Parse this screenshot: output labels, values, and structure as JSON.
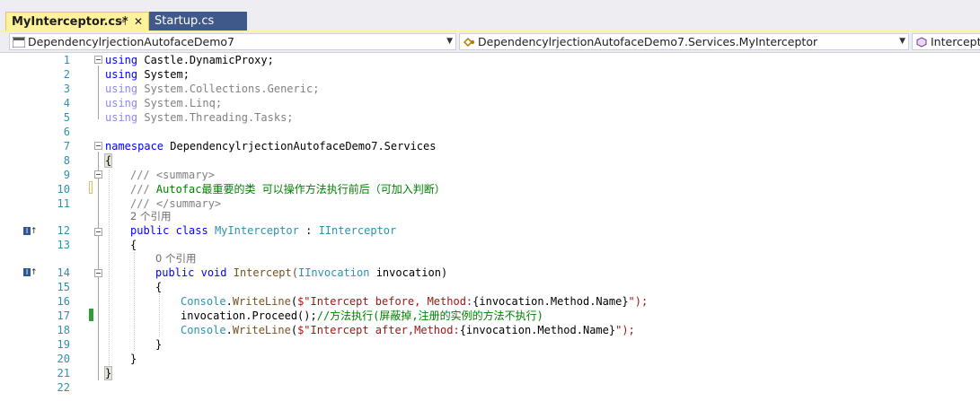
{
  "tabs": [
    {
      "label": "MyInterceptor.cs*",
      "active": true,
      "pin_icon": "pin-icon",
      "close_icon": "close-icon"
    },
    {
      "label": "Startup.cs",
      "active": false
    }
  ],
  "nav": {
    "project": "DependencylrjectionAutofaceDemo7",
    "type": "DependencylrjectionAutofaceDemo7.Services.MyInterceptor",
    "member": "Intercept("
  },
  "lines": [
    {
      "n": "1"
    },
    {
      "n": "2"
    },
    {
      "n": "3"
    },
    {
      "n": "4"
    },
    {
      "n": "5"
    },
    {
      "n": "6"
    },
    {
      "n": "7"
    },
    {
      "n": "8"
    },
    {
      "n": "9"
    },
    {
      "n": "10"
    },
    {
      "n": "11"
    },
    {
      "n": "12"
    },
    {
      "n": "13"
    },
    {
      "n": "14"
    },
    {
      "n": "15"
    },
    {
      "n": "16"
    },
    {
      "n": "17"
    },
    {
      "n": "18"
    },
    {
      "n": "19"
    },
    {
      "n": "20"
    },
    {
      "n": "21"
    },
    {
      "n": "22"
    }
  ],
  "code": {
    "l1_kw": "using",
    "l1_rest": " Castle.DynamicProxy;",
    "l2_kw": "using",
    "l2_rest": " System;",
    "l3_kw": "using",
    "l3_rest": " System.Collections.Generic;",
    "l4_kw": "using",
    "l4_rest": " System.Linq;",
    "l5_kw": "using",
    "l5_rest": " System.Threading.Tasks;",
    "l7_kw": "namespace",
    "l7_rest": " DependencylrjectionAutofaceDemo7.Services",
    "l8": "{",
    "l9_a": "/// ",
    "l9_b": "<summary>",
    "l10_a": "/// ",
    "l10_b": "Autofac最重要的类 可以操作方法执行前后（可加入判断）",
    "l11_a": "/// ",
    "l11_b": "</summary>",
    "ref_class": "2 个引用",
    "l12_kw1": "public",
    "l12_kw2": "class",
    "l12_name": "MyInterceptor",
    "l12_sep": " : ",
    "l12_base": "IInterceptor",
    "l13": "{",
    "ref_method": "0 个引用",
    "l14_kw1": "public",
    "l14_kw2": "void",
    "l14_name": "Intercept(",
    "l14_type": "IInvocation",
    "l14_rest": " invocation)",
    "l15": "{",
    "l16_cls": "Console",
    "l16_dot": ".",
    "l16_m": "WriteLine",
    "l16_p": "(",
    "l16_str": "$\"Intercept before, Method:",
    "l16_interp": "{invocation.Method.Name}",
    "l16_end": "\");",
    "l17_code": "invocation.Proceed();",
    "l17_cm": "//方法执行(屏蔽掉,注册的实例的方法不执行)",
    "l18_cls": "Console",
    "l18_dot": ".",
    "l18_m": "WriteLine",
    "l18_p": "(",
    "l18_str": "$\"Intercept after,Method:",
    "l18_interp": "{invocation.Method.Name}",
    "l18_end": "\");",
    "l19": "}",
    "l20": "}",
    "l21": "}"
  },
  "impl_markers": [
    "I↑",
    "I↑"
  ],
  "colors": {
    "keyword": "#0000ff",
    "type": "#2b91af",
    "comment": "#008000",
    "string": "#a31515",
    "tab_active": "#fff29d"
  }
}
